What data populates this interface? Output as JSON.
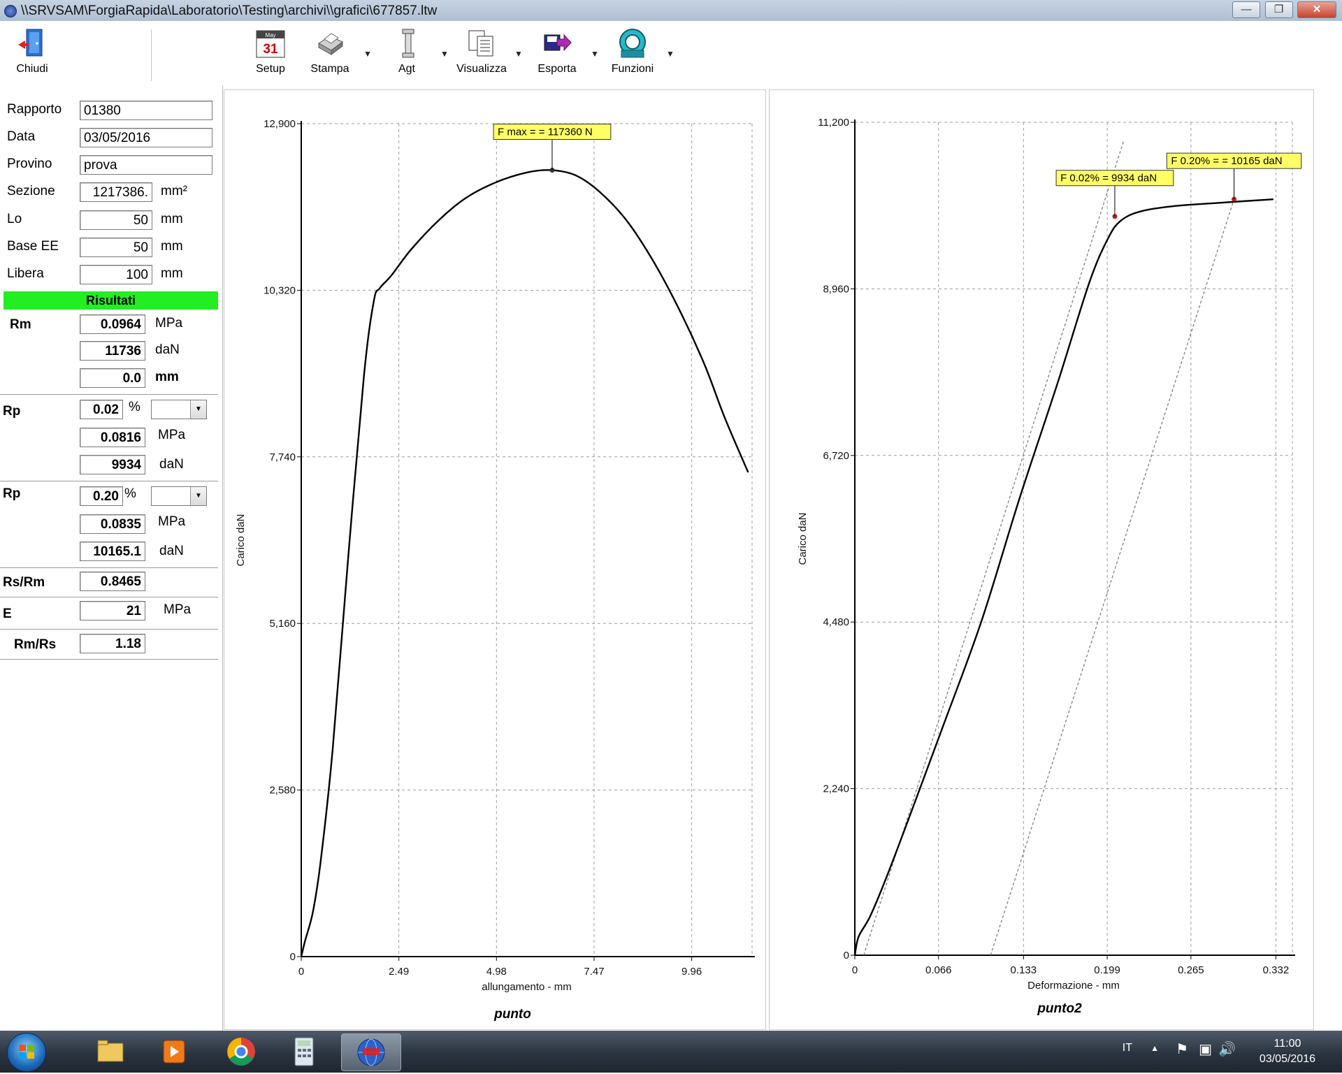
{
  "window": {
    "title": "\\\\SRVSAM\\ForgiaRapida\\Laboratorio\\Testing\\archivi\\\\grafici\\677857.ltw",
    "buttons": [
      "minimize",
      "maximize",
      "close"
    ]
  },
  "toolbar": {
    "chiudi": "Chiudi",
    "setup": "Setup",
    "stampa": "Stampa",
    "agt": "Agt",
    "visualizza": "Visualizza",
    "esporta": "Esporta",
    "funzioni": "Funzioni",
    "calendar_day": "31",
    "calendar_month": "May"
  },
  "form": {
    "rapporto_label": "Rapporto",
    "rapporto_value": "01380",
    "data_label": "Data",
    "data_value": "03/05/2016",
    "provino_label": "Provino",
    "provino_value": "prova",
    "sezione_label": "Sezione",
    "sezione_value": "1217386.",
    "sezione_unit": "mm²",
    "lo_label": "Lo",
    "lo_value": "50",
    "lo_unit": "mm",
    "base_label": "Base EE",
    "base_value": "50",
    "base_unit": "mm",
    "libera_label": "Libera",
    "libera_value": "100",
    "libera_unit": "mm"
  },
  "results": {
    "header": "Risultati",
    "rm_label": "Rm",
    "rm_mpa": "0.0964",
    "rm_mpa_unit": "MPa",
    "rm_dan": "11736",
    "rm_dan_unit": "daN",
    "rm_mm": "0.0",
    "rm_mm_unit": "mm",
    "rp1_label": "Rp",
    "rp1_pct": "0.02",
    "rp1_pct_unit": "%",
    "rp1_mpa": "0.0816",
    "rp1_mpa_unit": "MPa",
    "rp1_dan": "9934",
    "rp1_dan_unit": "daN",
    "rp2_label": "Rp",
    "rp2_pct": "0.20",
    "rp2_pct_unit": "%",
    "rp2_mpa": "0.0835",
    "rp2_mpa_unit": "MPa",
    "rp2_dan": "10165.1",
    "rp2_dan_unit": "daN",
    "rsrm_label": "Rs/Rm",
    "rsrm_value": "0.8465",
    "e_label": "E",
    "e_value": "21",
    "e_unit": "MPa",
    "rmrs_label": "Rm/Rs",
    "rmrs_value": "1.18"
  },
  "chart_data": [
    {
      "type": "line",
      "title": "punto",
      "xlabel": "allungamento - mm",
      "ylabel": "Carico  daN",
      "xlim": [
        0,
        11.5
      ],
      "ylim": [
        0,
        12900
      ],
      "x_ticks": [
        "0",
        "2.49",
        "4.98",
        "7.47",
        "9.96"
      ],
      "x_tick_values": [
        0,
        2.49,
        4.98,
        7.47,
        9.96
      ],
      "y_ticks": [
        "0",
        "2,580",
        "5,160",
        "7,740",
        "10,320",
        "12,900"
      ],
      "y_tick_values": [
        0,
        2580,
        5160,
        7740,
        10320,
        12900
      ],
      "grid": true,
      "series": [
        {
          "x": [
            0,
            0.1,
            0.3,
            0.5,
            0.8,
            1.2,
            1.6,
            1.85,
            2.0,
            2.3,
            2.8,
            3.5,
            4.2,
            5.0,
            5.8,
            6.4,
            7.0,
            7.6,
            8.3,
            9.0,
            9.7,
            10.3,
            10.8,
            11.4
          ],
          "y": [
            0,
            250,
            700,
            1500,
            3200,
            6200,
            9000,
            10150,
            10350,
            10550,
            10950,
            11400,
            11750,
            12000,
            12150,
            12180,
            12100,
            11850,
            11400,
            10750,
            9950,
            9150,
            8350,
            7500
          ]
        }
      ],
      "annotations": [
        {
          "text": "F max =  = 117360 N",
          "x": 6.4,
          "y": 12180
        }
      ]
    },
    {
      "type": "line",
      "title": "punto2",
      "xlabel": "Deformazione - mm",
      "ylabel": "Carico  daN",
      "xlim": [
        0,
        0.345
      ],
      "ylim": [
        0,
        11200
      ],
      "x_ticks": [
        "0",
        "0.066",
        "0.133",
        "0.199",
        "0.265",
        "0.332"
      ],
      "x_tick_values": [
        0,
        0.066,
        0.133,
        0.199,
        0.265,
        0.332
      ],
      "y_ticks": [
        "0",
        "2,240",
        "4,480",
        "6,720",
        "8,960",
        "11,200"
      ],
      "y_tick_values": [
        0,
        2240,
        4480,
        6720,
        8960,
        11200
      ],
      "grid": true,
      "series": [
        {
          "x": [
            0,
            0.003,
            0.012,
            0.025,
            0.045,
            0.07,
            0.1,
            0.13,
            0.16,
            0.185,
            0.2,
            0.21,
            0.225,
            0.25,
            0.29,
            0.33
          ],
          "y": [
            0,
            250,
            520,
            1050,
            1950,
            3100,
            4500,
            6150,
            7700,
            9050,
            9650,
            9880,
            10000,
            10070,
            10120,
            10165
          ]
        }
      ],
      "offset_lines": [
        {
          "x": [
            0.007,
            0.212
          ],
          "y": [
            0,
            10950
          ]
        },
        {
          "x": [
            0.107,
            0.299
          ],
          "y": [
            0,
            10165
          ]
        }
      ],
      "annotations": [
        {
          "text": "F 0.02%  = 9934 daN",
          "x": 0.205,
          "y": 9934
        },
        {
          "text": "F 0.20% =  = 10165 daN",
          "x": 0.299,
          "y": 10165
        }
      ]
    }
  ],
  "taskbar": {
    "lang": "IT",
    "time": "11:00",
    "date": "03/05/2016"
  }
}
